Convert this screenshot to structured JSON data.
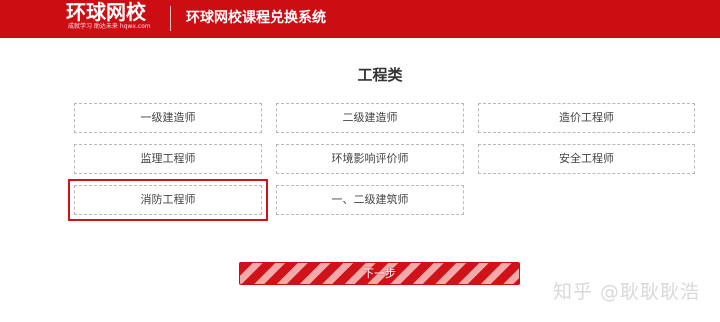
{
  "header": {
    "logo_main": "环球网校",
    "logo_sub": "成就学习 助达未来 hqwx.com",
    "title": "环球网校课程兑换系统"
  },
  "section": {
    "title": "工程类"
  },
  "options": [
    {
      "label": "一级建造师",
      "selected": false
    },
    {
      "label": "二级建造师",
      "selected": false
    },
    {
      "label": "造价工程师",
      "selected": false
    },
    {
      "label": "监理工程师",
      "selected": false
    },
    {
      "label": "环境影响评价师",
      "selected": false
    },
    {
      "label": "安全工程师",
      "selected": false
    },
    {
      "label": "消防工程师",
      "selected": true
    },
    {
      "label": "一、二级建筑师",
      "selected": false
    }
  ],
  "next_button": {
    "label": "下一步"
  },
  "watermark": "知乎 @耿耿耿浩",
  "colors": {
    "brand_red": "#cc0d12",
    "stripe_light": "#f4a9ab"
  }
}
